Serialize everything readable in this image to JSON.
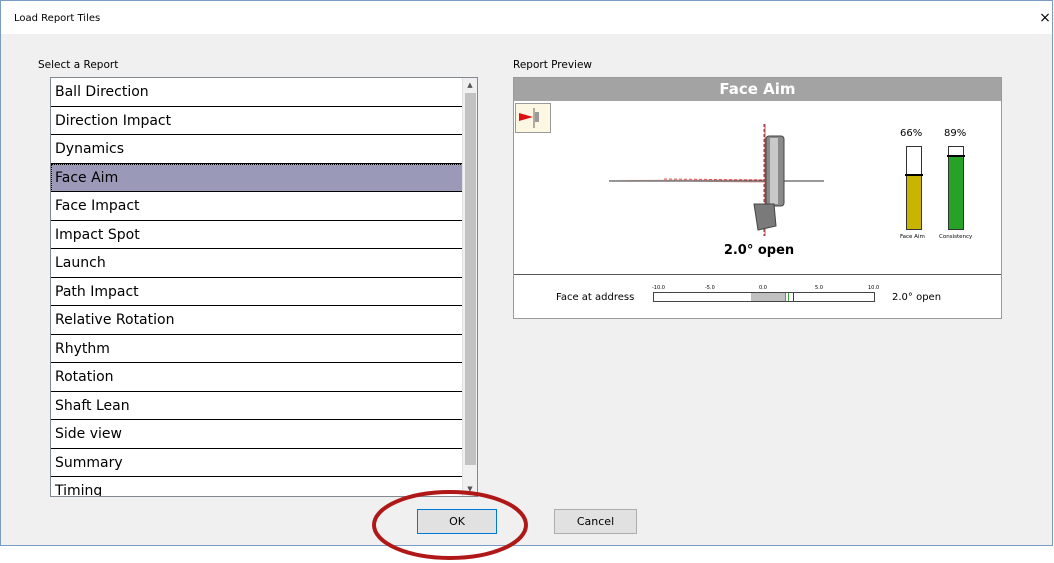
{
  "window": {
    "title": "Load Report Tiles",
    "close_glyph": "×"
  },
  "left": {
    "section_label": "Select a Report",
    "reports": [
      "Ball Direction",
      "Direction Impact",
      "Dynamics",
      "Face Aim",
      "Face Impact",
      "Impact Spot",
      "Launch",
      "Path Impact",
      "Relative Rotation",
      "Rhythm",
      "Rotation",
      "Shaft Lean",
      "Side view",
      "Summary",
      "Timing"
    ],
    "selected": "Face Aim"
  },
  "preview": {
    "section_label": "Report Preview",
    "tile_title": "Face Aim",
    "face_angle_text": "2.0° open",
    "bars": [
      {
        "pct_label": "66%",
        "caption": "Face Aim",
        "level": 0.66,
        "color": "#c9b400"
      },
      {
        "pct_label": "89%",
        "caption": "Consistency",
        "level": 0.89,
        "color": "#27a227"
      }
    ],
    "address_label": "Face at address",
    "scale_ticks": [
      "-10.0",
      "-5.0",
      "0.0",
      "5.0",
      "10.0"
    ],
    "address_value": "2.0° open"
  },
  "buttons": {
    "ok": "OK",
    "cancel": "Cancel"
  },
  "colors": {
    "selected_row": "#9a9ab8",
    "header_grey": "#a3a3a3",
    "highlight_ring": "#b01818"
  }
}
